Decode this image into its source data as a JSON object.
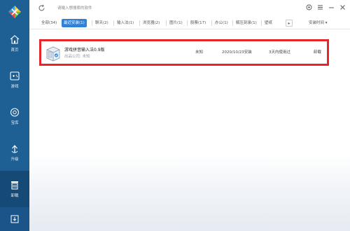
{
  "topbar": {
    "search_placeholder": "请输入想搜索的软件"
  },
  "tabs": [
    {
      "label": "全部(34)",
      "active": false
    },
    {
      "label": "最近安装(1)",
      "active": true
    },
    {
      "label": "聊天(2)",
      "active": false
    },
    {
      "label": "输入法(1)",
      "active": false
    },
    {
      "label": "浏览器(2)",
      "active": false
    },
    {
      "label": "图片(1)",
      "active": false
    },
    {
      "label": "股票(17)",
      "active": false
    },
    {
      "label": "办公(1)",
      "active": false
    },
    {
      "label": "解压刻录(1)",
      "active": false
    },
    {
      "label": "壁纸",
      "active": false
    }
  ],
  "tab_more": "▸",
  "sort_label": "安装时间 ▾",
  "sidebar": {
    "items": [
      {
        "label": "首页",
        "icon": "home-icon"
      },
      {
        "label": "游戏",
        "icon": "gamepad-icon"
      },
      {
        "label": "宝库",
        "icon": "treasure-icon"
      },
      {
        "label": "升级",
        "icon": "upgrade-icon"
      },
      {
        "label": "卸载",
        "icon": "uninstall-icon"
      }
    ],
    "active_index": 4
  },
  "apps": [
    {
      "name": "游戏拼音输入法0.9版",
      "company": "出品公司: 未知",
      "size": "未知",
      "install_date": "2020/10/23安装",
      "last_used": "3天内使用过",
      "action": "卸载"
    }
  ],
  "colors": {
    "sidebar": "#1e5f94",
    "accent": "#2f80d6",
    "highlight_border": "#e8262a"
  }
}
